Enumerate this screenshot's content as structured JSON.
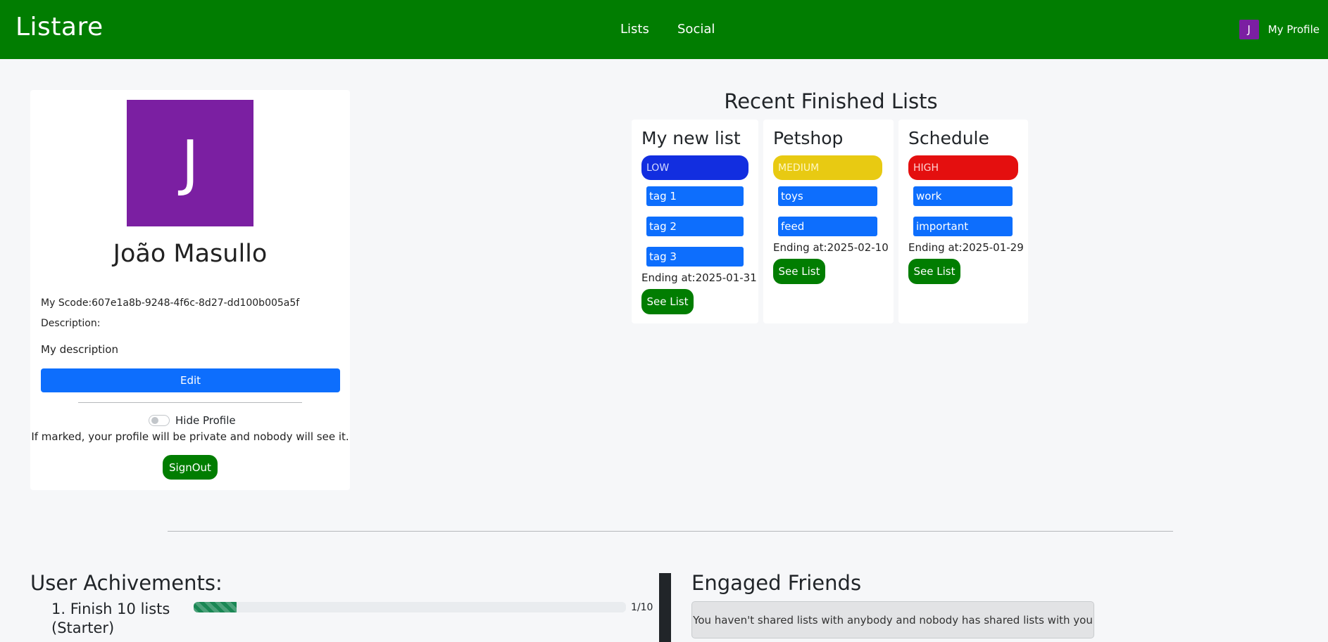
{
  "navbar": {
    "brand": "Listare",
    "links": [
      "Lists",
      "Social"
    ],
    "profile_initial": "J",
    "profile_label": "My Profile"
  },
  "profile": {
    "avatar_initial": "J",
    "name": "João Masullo",
    "scode": "My Scode:607e1a8b-9248-4f6c-8d27-dd100b005a5f",
    "description_label": "Description:",
    "description": "My description",
    "edit_label": "Edit",
    "hide_label": "Hide Profile",
    "hide_checked": false,
    "private_note": "If marked, your profile will be private and nobody will see it.",
    "signout_label": "SignOut"
  },
  "recent": {
    "title": "Recent Finished Lists",
    "lists": [
      {
        "title": "My new list",
        "priority": "LOW",
        "priority_color": "#122ee0",
        "priority_text_color": "#d6dbff",
        "tags": [
          "tag 1",
          "tag 2",
          "tag 3"
        ],
        "ending": "Ending at:2025-01-31",
        "button": "See List"
      },
      {
        "title": "Petshop",
        "priority": "MEDIUM",
        "priority_color": "#e8ca12",
        "priority_text_color": "#fff7c4",
        "tags": [
          "toys",
          "feed"
        ],
        "ending": "Ending at:2025-02-10",
        "button": "See List"
      },
      {
        "title": "Schedule",
        "priority": "HIGH",
        "priority_color": "#e40f0f",
        "priority_text_color": "#ffd2d2",
        "tags": [
          "work",
          "important"
        ],
        "ending": "Ending at:2025-01-29",
        "button": "See List"
      }
    ]
  },
  "achievements": {
    "title": "User Achivements:",
    "items": [
      {
        "name": "1. Finish 10 lists (Starter)",
        "progress_text": "1/10",
        "progress": 0.1
      }
    ]
  },
  "friends": {
    "title": "Engaged Friends",
    "message": "You haven't shared lists with anybody and nobody has shared lists with you"
  }
}
